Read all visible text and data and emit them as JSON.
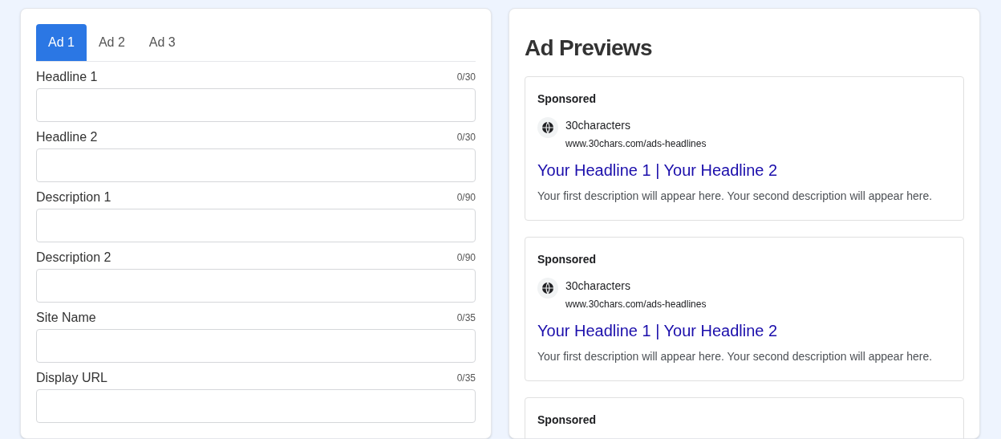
{
  "tabs": [
    {
      "label": "Ad 1",
      "selected": true
    },
    {
      "label": "Ad 2",
      "selected": false
    },
    {
      "label": "Ad 3",
      "selected": false
    }
  ],
  "fields": [
    {
      "label": "Headline 1",
      "count": "0/30"
    },
    {
      "label": "Headline 2",
      "count": "0/30"
    },
    {
      "label": "Description 1",
      "count": "0/90"
    },
    {
      "label": "Description 2",
      "count": "0/90"
    },
    {
      "label": "Site Name",
      "count": "0/35"
    },
    {
      "label": "Display URL",
      "count": "0/35"
    }
  ],
  "previews": {
    "title": "Ad Previews",
    "cards": [
      {
        "sponsored": "Sponsored",
        "site_name": "30characters",
        "url": "www.30chars.com/ads-headlines",
        "headline": "Your Headline 1 | Your Headline 2",
        "description": "Your first description will appear here. Your second description will appear here."
      },
      {
        "sponsored": "Sponsored",
        "site_name": "30characters",
        "url": "www.30chars.com/ads-headlines",
        "headline": "Your Headline 1 | Your Headline 2",
        "description": "Your first description will appear here. Your second description will appear here."
      },
      {
        "sponsored": "Sponsored"
      }
    ]
  }
}
